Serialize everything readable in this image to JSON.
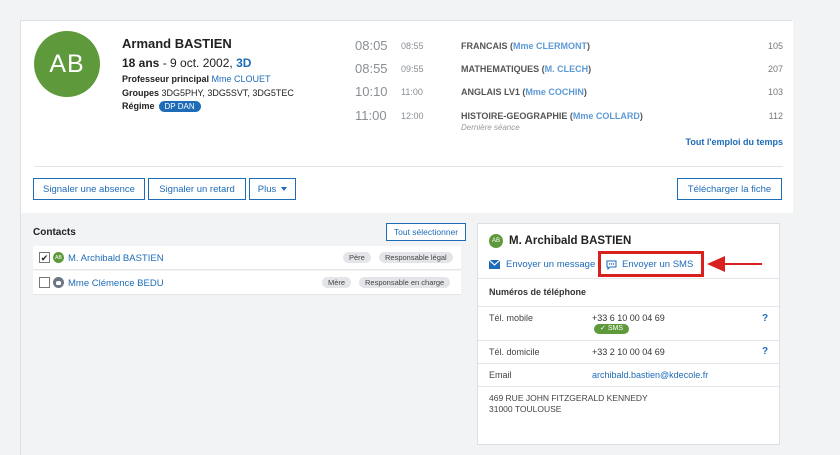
{
  "student": {
    "initials": "AB",
    "name": "Armand BASTIEN",
    "age": "18 ans",
    "birth": " - 9 oct. 2002, ",
    "class": "3D",
    "principal_label": "Professeur principal",
    "principal_value": "Mme CLOUET",
    "groups_label": "Groupes",
    "groups_value": "3DG5PHY, 3DG5SVT, 3DG5TEC",
    "regime_label": "Régime",
    "regime_value": "DP DAN"
  },
  "schedule": [
    {
      "start": "08:05",
      "end": "08:55",
      "subject": "FRANCAIS",
      "teacher": "Mme CLERMONT",
      "room": "105",
      "note": ""
    },
    {
      "start": "08:55",
      "end": "09:55",
      "subject": "MATHEMATIQUES",
      "teacher": "M. CLECH",
      "room": "207",
      "note": ""
    },
    {
      "start": "10:10",
      "end": "11:00",
      "subject": "ANGLAIS LV1",
      "teacher": "Mme COCHIN",
      "room": "103",
      "note": ""
    },
    {
      "start": "11:00",
      "end": "12:00",
      "subject": "HISTOIRE-GEOGRAPHIE",
      "teacher": "Mme COLLARD",
      "room": "112",
      "note": "Dernière séance"
    }
  ],
  "full_schedule_link": "Tout l'emploi du temps",
  "actions": {
    "report_absence": "Signaler une absence",
    "report_late": "Signaler un retard",
    "more": "Plus",
    "download_sheet": "Télécharger la fiche"
  },
  "contacts": {
    "title": "Contacts",
    "select_all": "Tout sélectionner",
    "items": [
      {
        "checked": "✔",
        "initials": "AB",
        "name": "M. Archibald BASTIEN",
        "relation": "Père",
        "role": "Responsable légal"
      },
      {
        "checked": "",
        "initials": "",
        "name": "Mme Clémence BEDU",
        "relation": "Mère",
        "role": "Responsable en charge"
      }
    ]
  },
  "detail": {
    "initials": "AB",
    "name": "M. Archibald BASTIEN",
    "send_message": "Envoyer un message",
    "send_sms": "Envoyer un SMS",
    "phones_title": "Numéros de téléphone",
    "mobile_label": "Tél. mobile",
    "mobile_value": "+33 6 10 00 04 69",
    "sms_badge": "SMS",
    "home_label": "Tél. domicile",
    "home_value": "+33 2 10 00 04 69",
    "help": "?",
    "email_label": "Email",
    "email_value": "archibald.bastien@kdecole.fr",
    "address_line1": "469 RUE JOHN FITZGERALD KENNEDY",
    "address_line2": "31000 TOULOUSE"
  },
  "colors": {
    "accent": "#1e6bb8",
    "avatar": "#5e9a3b",
    "highlight": "#d8201f"
  }
}
